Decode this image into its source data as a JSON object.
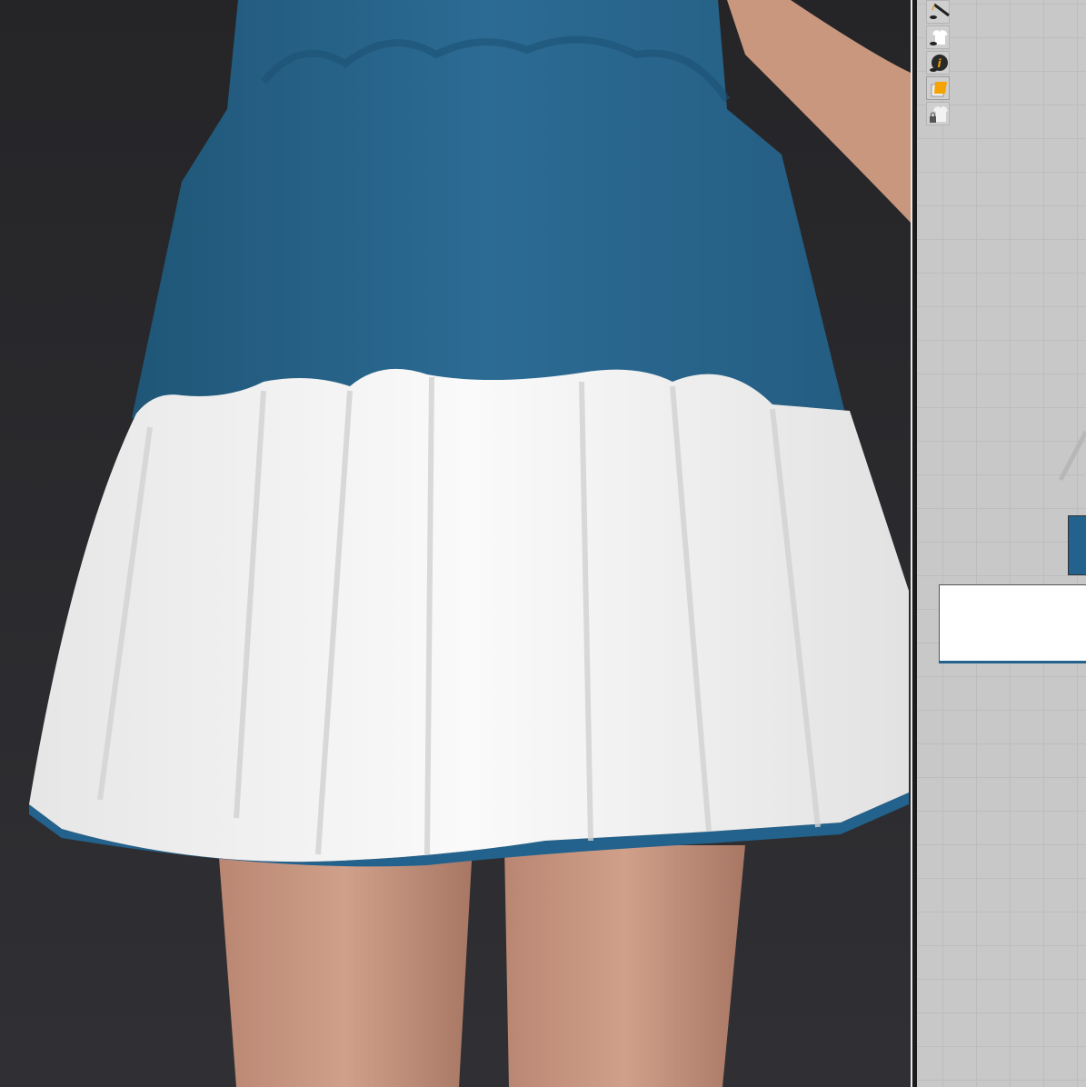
{
  "viewport": {
    "garment_colors": {
      "body_tier": "#2a6790",
      "bottom_tier": "#f4f4f4",
      "hem_binding": "#23628c"
    },
    "background": "#2b2b2f"
  },
  "pattern_window": {
    "toolbar_icons": [
      "show-internal-lines-icon",
      "show-garment-icon",
      "show-info-icon",
      "fabric-texture-icon",
      "lock-garment-icon"
    ],
    "pieces": [
      {
        "name": "blue-tier-piece",
        "color": "#23628c"
      },
      {
        "name": "white-tier-piece",
        "color": "#ffffff"
      }
    ]
  }
}
